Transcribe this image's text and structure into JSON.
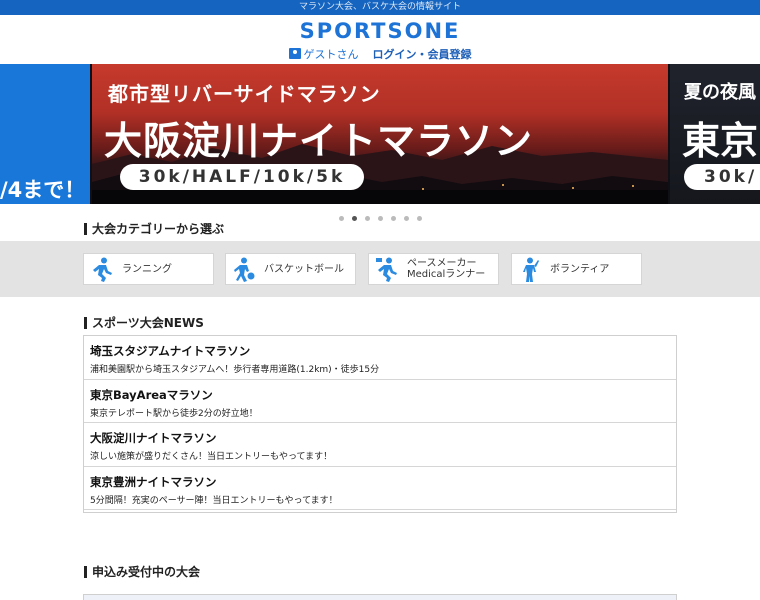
{
  "topbar": {
    "text": "マラソン大会、バスケ大会の情報サイト"
  },
  "header": {
    "logo": "SPORTSONE",
    "guest": "ゲストさん",
    "login": "ログイン・会員登録"
  },
  "hero": {
    "left_text": "/4まで！",
    "slides": [
      {
        "sub": "都市型リバーサイドマラソン",
        "main": "大阪淀川ナイトマラソン",
        "distances": "30k/HALF/10k/5k"
      },
      {
        "sub": "夏の夜風",
        "main": "東京",
        "distances": "30k/"
      }
    ],
    "dot_count": 7,
    "active_dot": 1
  },
  "categories": {
    "title": "大会カテゴリーから選ぶ",
    "items": [
      {
        "label": "ランニング",
        "icon": "runner-icon"
      },
      {
        "label": "バスケットボール",
        "icon": "basketball-player-icon"
      },
      {
        "label": "ペースメーカー\nMedicalランナー",
        "icon": "pacemaker-runner-icon"
      },
      {
        "label": "ボランティア",
        "icon": "volunteer-icon"
      }
    ]
  },
  "news": {
    "title": "スポーツ大会NEWS",
    "items": [
      {
        "title": "埼玉スタジアムナイトマラソン",
        "desc": "浦和美園駅から埼玉スタジアムへ！歩行者専用道路(1.2km)・徒歩15分"
      },
      {
        "title": "東京BayAreaマラソン",
        "desc": "東京テレポート駅から徒歩2分の好立地！"
      },
      {
        "title": "大阪淀川ナイトマラソン",
        "desc": "涼しい施策が盛りだくさん！当日エントリーもやってます！"
      },
      {
        "title": "東京豊洲ナイトマラソン",
        "desc": "5分間隔！充実のペーサー陣！当日エントリーもやってます！"
      }
    ]
  },
  "entries": {
    "title": "申込み受付中の大会"
  },
  "colors": {
    "brand": "#1e73d6",
    "topbar": "#1565c0"
  }
}
